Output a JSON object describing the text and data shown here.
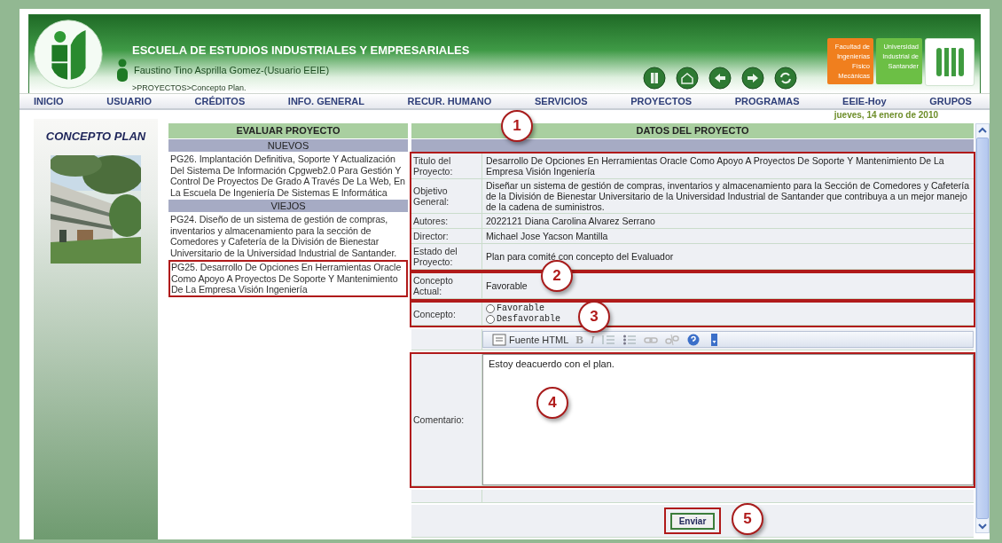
{
  "header": {
    "title": "ESCUELA DE ESTUDIOS INDUSTRIALES Y EMPRESARIALES",
    "user": "Faustino Tino Asprilla Gomez-(Usuario EEIE)",
    "breadcrumb": ">PROYECTOS>Concepto Plan.",
    "badges": [
      {
        "lines": [
          "Facultad de",
          "Ingenierías",
          "Físico",
          "Mecánicas"
        ],
        "color": "#f07f1e"
      },
      {
        "lines": [
          "Universidad",
          "Industrial de",
          "Santander"
        ],
        "color": "#6cbf45"
      }
    ]
  },
  "nav": [
    "INICIO",
    "USUARIO",
    "CRÉDITOS",
    "INFO. GENERAL",
    "RECUR. HUMANO",
    "SERVICIOS",
    "PROYECTOS",
    "PROGRAMAS",
    "EEIE-Hoy",
    "GRUPOS"
  ],
  "date": "jueves, 14 enero de 2010",
  "sidebar": {
    "title": "CONCEPTO PLAN"
  },
  "evaluate": {
    "title": "EVALUAR PROYECTO",
    "sections": [
      {
        "heading": "NUEVOS",
        "items": [
          {
            "text": "PG26. Implantación Definitiva, Soporte Y Actualización Del Sistema De Información Cpgweb2.0 Para Gestión Y Control De Proyectos De Grado A Través De La Web, En La Escuela De Ingeniería De Sistemas E Informática",
            "selected": false
          }
        ]
      },
      {
        "heading": "VIEJOS",
        "items": [
          {
            "text": "PG24. Diseño de un sistema de gestión de compras, inventarios y almacenamiento para la sección de Comedores y Cafetería de la División de Bienestar Universitario de la Universidad Industrial de Santander.",
            "selected": false
          },
          {
            "text": "PG25. Desarrollo De Opciones En Herramientas Oracle Como Apoyo A Proyectos De Soporte Y Mantenimiento De La Empresa Visión Ingeniería",
            "selected": true
          }
        ]
      }
    ]
  },
  "details": {
    "title": "DATOS DEL PROYECTO",
    "groups": [
      {
        "framed": true,
        "rows": [
          {
            "kind": "text",
            "label": "Titulo del Proyecto:",
            "value": "Desarrollo De Opciones En Herramientas Oracle Como Apoyo A Proyectos De Soporte Y Mantenimiento De La Empresa Visión Ingeniería"
          },
          {
            "kind": "text",
            "label": "Objetivo General:",
            "value": "Diseñar un sistema de gestión de compras, inventarios y almacenamiento para la Sección de Comedores y Cafetería de la División de Bienestar Universitario de la Universidad Industrial de Santander que contribuya a un mejor manejo de la cadena de suministros."
          },
          {
            "kind": "text",
            "label": "Autores:",
            "value": "2022121 Diana Carolina Alvarez Serrano"
          },
          {
            "kind": "text",
            "label": "Director:",
            "value": "Michael Jose Yacson Mantilla"
          },
          {
            "kind": "text",
            "label": "Estado del Proyecto:",
            "value": "Plan para comité con concepto del Evaluador"
          }
        ]
      },
      {
        "framed": true,
        "rows": [
          {
            "kind": "text",
            "label": "Concepto Actual:",
            "value": "Favorable"
          }
        ]
      },
      {
        "framed": true,
        "rows": [
          {
            "kind": "radio",
            "label": "Concepto:",
            "options": [
              {
                "label": "Favorable",
                "selected": false
              },
              {
                "label": "Desfavorable",
                "selected": false
              }
            ]
          }
        ]
      },
      {
        "framed": false,
        "rows": [
          {
            "kind": "toolbar",
            "items": [
              {
                "kind": "source",
                "label": "Fuente HTML"
              },
              {
                "kind": "bold",
                "label": "B"
              },
              {
                "kind": "italic",
                "label": "I"
              },
              {
                "kind": "ol"
              },
              {
                "kind": "ul"
              },
              {
                "kind": "link"
              },
              {
                "kind": "unlink"
              },
              {
                "kind": "help"
              },
              {
                "kind": "more"
              }
            ]
          }
        ]
      },
      {
        "framed": true,
        "rows": [
          {
            "kind": "editor",
            "label": "Comentario:",
            "value": "Estoy deacuerdo con el plan."
          }
        ]
      },
      {
        "framed": false,
        "rows": [
          {
            "kind": "blank"
          }
        ]
      }
    ],
    "submit": {
      "label": "Enviar",
      "framed": true
    }
  },
  "callouts": [
    "1",
    "2",
    "3",
    "4",
    "5"
  ]
}
